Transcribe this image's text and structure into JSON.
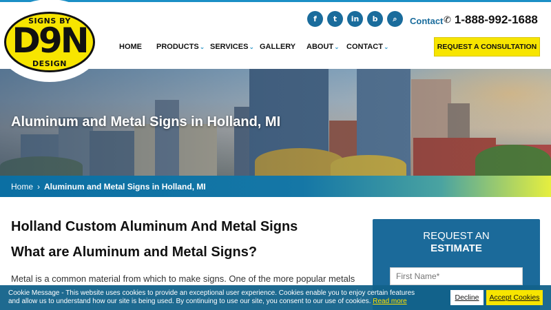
{
  "logo": {
    "top_text": "SIGNS BY",
    "main_text": "D9N",
    "bottom_text": "DESIGN"
  },
  "social": [
    {
      "icon": "facebook-icon",
      "glyph": "f"
    },
    {
      "icon": "twitter-icon",
      "glyph": "t"
    },
    {
      "icon": "linkedin-icon",
      "glyph": "in"
    },
    {
      "icon": "bing-icon",
      "glyph": "b"
    },
    {
      "icon": "search-icon",
      "glyph": "⌕"
    }
  ],
  "header": {
    "contact_label": "Contact",
    "phone": "1-888-992-1688",
    "consult_button": "REQUEST A CONSULTATION"
  },
  "nav": [
    {
      "label": "HOME",
      "dropdown": false
    },
    {
      "label": "PRODUCTS",
      "dropdown": true
    },
    {
      "label": "SERVICES",
      "dropdown": true
    },
    {
      "label": "GALLERY",
      "dropdown": false
    },
    {
      "label": "ABOUT",
      "dropdown": true
    },
    {
      "label": "CONTACT",
      "dropdown": true
    }
  ],
  "hero": {
    "title": "Aluminum and Metal Signs in Holland, MI"
  },
  "breadcrumb": {
    "home": "Home",
    "separator": "›",
    "current": "Aluminum and Metal Signs in Holland, MI"
  },
  "main": {
    "heading1": "Holland Custom Aluminum And Metal Signs",
    "heading2": "What are Aluminum and Metal Signs?",
    "paragraph": "Metal is a common material from which to make signs. One of the more popular metals is"
  },
  "estimate": {
    "title_line1": "REQUEST AN",
    "title_line2": "ESTIMATE",
    "first_name_placeholder": "First Name*"
  },
  "cookie": {
    "text": "Cookie Message - This website uses cookies to provide an exceptional user experience. Cookies enable you to enjoy certain features and allow us to understand how our site is being used. By continuing to use our site, you consent to our use of cookies.",
    "link": "Read more",
    "decline": "Decline",
    "accept": "Accept Cookies"
  },
  "colors": {
    "brand_blue": "#1a6c9c",
    "accent_yellow": "#f7e500",
    "link_blue": "#1b8fc6"
  }
}
